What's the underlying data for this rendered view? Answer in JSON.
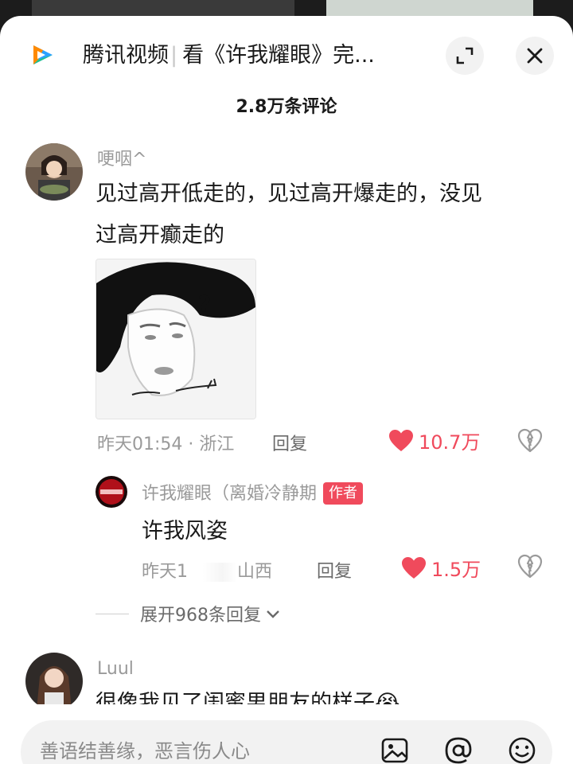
{
  "header": {
    "app_name": "腾讯视频",
    "separator": "|",
    "title": "看《许我耀眼》完..."
  },
  "comment_count": "2.8万条评论",
  "comments": [
    {
      "username": "哽咽^",
      "text_line1": "见过高开低走的，见过高开爆走的，没见",
      "text_line2": "过高开癫走的",
      "time_location": "昨天01:54 · 浙江",
      "reply_label": "回复",
      "likes": "10.7万",
      "reply": {
        "username": "许我耀眼（离婚冷静期",
        "badge": "作者",
        "text": "许我风姿",
        "time_prefix": "昨天1",
        "location": "山西",
        "reply_label": "回复",
        "likes": "1.5万"
      },
      "expand_label": "展开968条回复"
    },
    {
      "username": "Luul",
      "text": "很像我见了闺蜜男朋友的样子😭"
    }
  ],
  "input": {
    "placeholder": "善语结善缘，恶言伤人心"
  },
  "colors": {
    "like_red": "#f04a5c",
    "muted_text": "#9a9a9a"
  }
}
